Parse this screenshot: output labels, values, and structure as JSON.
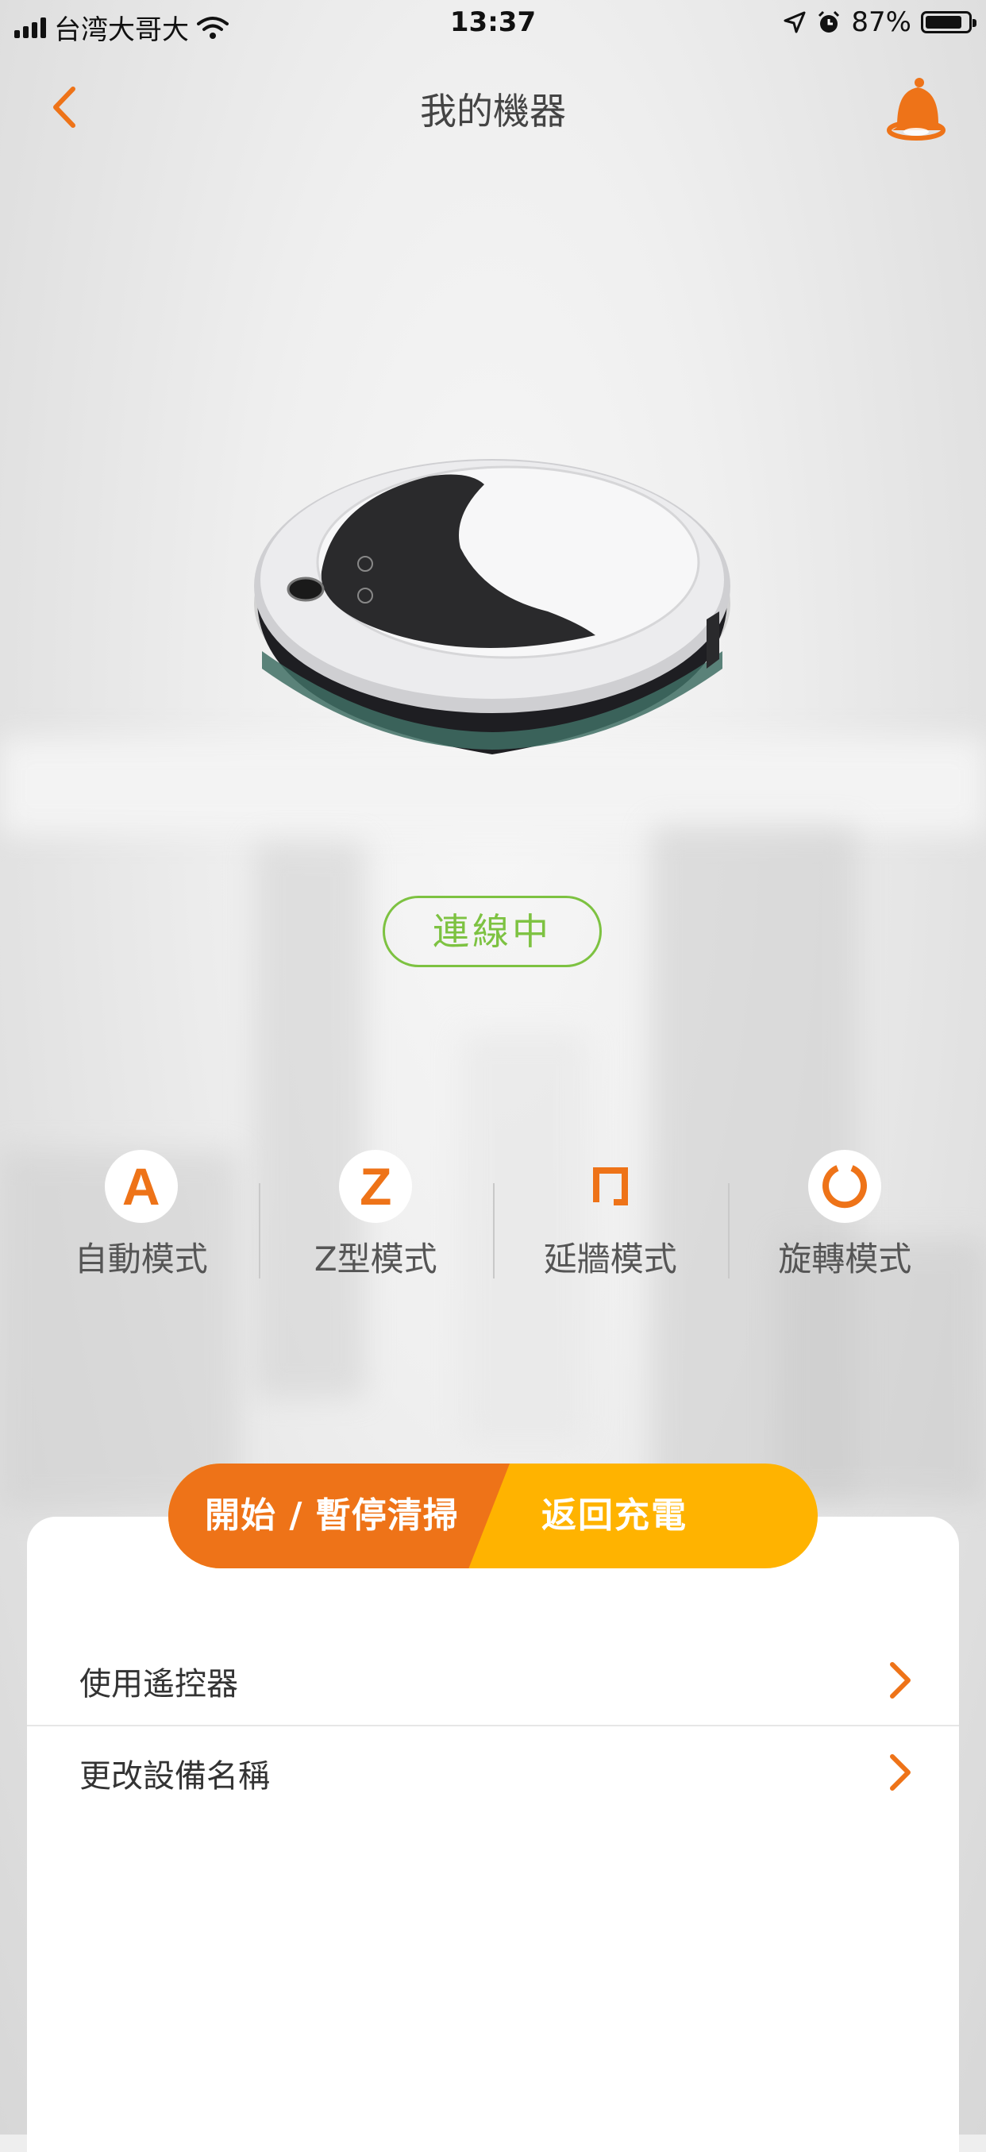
{
  "status_bar": {
    "carrier": "台湾大哥大",
    "time": "13:37",
    "battery_percent": "87%",
    "battery_level": 0.87
  },
  "nav": {
    "title": "我的機器",
    "back_icon": "chevron-left-icon",
    "bell_icon": "bell-icon"
  },
  "device": {
    "connection_status": "連線中"
  },
  "modes": [
    {
      "label": "自動模式",
      "icon": "auto-mode-icon",
      "glyph": "A"
    },
    {
      "label": "Z型模式",
      "icon": "z-mode-icon",
      "glyph": "Z"
    },
    {
      "label": "延牆模式",
      "icon": "wall-mode-icon",
      "glyph": ""
    },
    {
      "label": "旋轉模式",
      "icon": "spiral-mode-icon",
      "glyph": ""
    }
  ],
  "actions": {
    "start_pause": "開始 / 暫停清掃",
    "return_charge": "返回充電"
  },
  "menu": [
    {
      "label": "使用遙控器"
    },
    {
      "label": "更改設備名稱"
    }
  ],
  "colors": {
    "accent_orange": "#ee7318",
    "accent_yellow": "#ffb300",
    "status_green": "#7dc241"
  }
}
